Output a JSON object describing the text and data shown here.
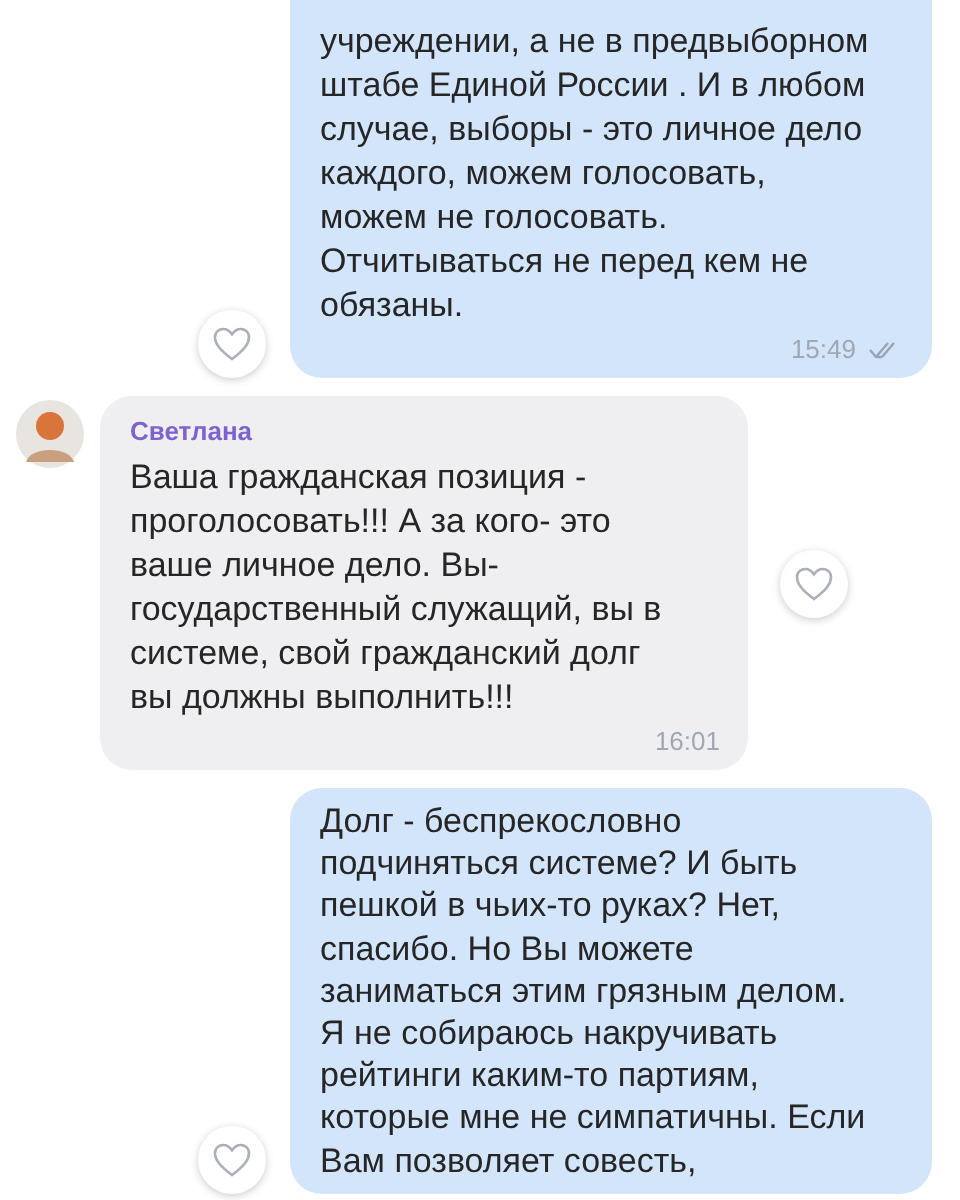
{
  "messages": [
    {
      "kind": "outgoing",
      "text": "учреждении, а не в предвыборном\nштабе Единой России . И в любом\nслучае, выборы - это личное дело\nкаждого, можем голосовать,\nможем не голосовать.\nОтчитываться не перед кем не\nобязаны.",
      "time": "15:49"
    },
    {
      "kind": "incoming",
      "sender": "Светлана",
      "text": "Ваша гражданская позиция -\nпроголосовать!!! А за кого- это\nваше личное дело. Вы-\nгосударственный служащий, вы в\nсистеме, свой гражданский долг\nвы должны выполнить!!!",
      "time": "16:01"
    },
    {
      "kind": "outgoing",
      "text": "Долг - беспрекословно\nподчиняться системе? И быть\nпешкой в чьих-то руках? Нет,\nспасибо. Но Вы можете\nзаниматься этим грязным делом.\nЯ не собираюсь накручивать\nрейтинги каким-то партиям,\nкоторые мне не симпатичны. Если\nВам позволяет совесть,"
    }
  ]
}
